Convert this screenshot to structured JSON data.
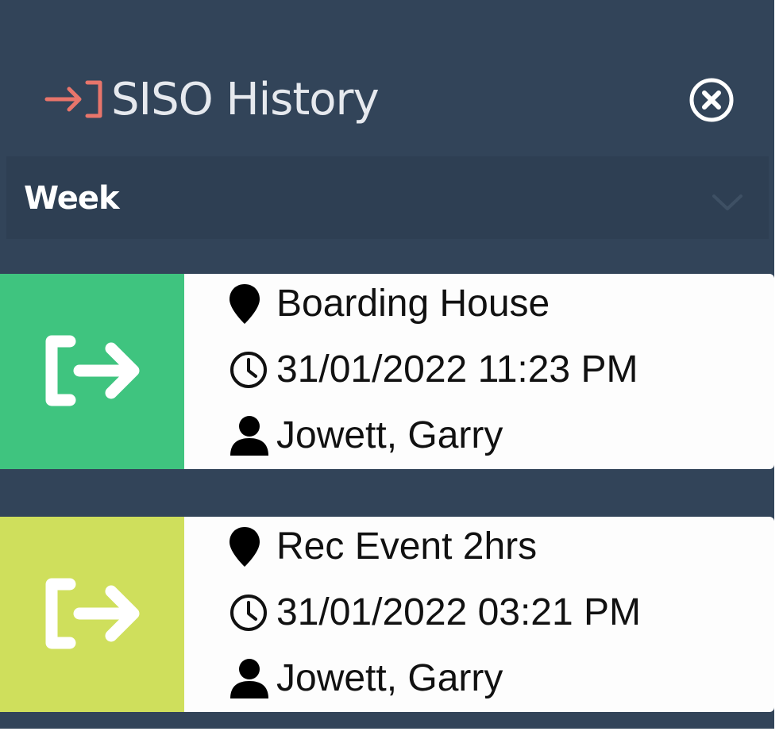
{
  "header": {
    "title": "SISO History"
  },
  "filter": {
    "selected": "Week"
  },
  "entries": [
    {
      "location": "Boarding House",
      "datetime": "31/01/2022 11:23 PM",
      "person": "Jowett, Garry",
      "status_color": "#3fc47f"
    },
    {
      "location": "Rec Event 2hrs",
      "datetime": "31/01/2022 03:21 PM",
      "person": "Jowett, Garry",
      "status_color": "#cfdf5c"
    }
  ],
  "colors": {
    "panel_bg": "#324459",
    "filter_bg": "#2e3f53",
    "title_icon": "#e8756b",
    "card_bg": "#fdfdfd"
  },
  "icons": {
    "title": "sign-in-icon",
    "close": "close-circle-icon",
    "dropdown": "chevron-down-icon",
    "status": "sign-out-icon",
    "location": "map-marker-icon",
    "time": "clock-icon",
    "person": "user-icon"
  }
}
